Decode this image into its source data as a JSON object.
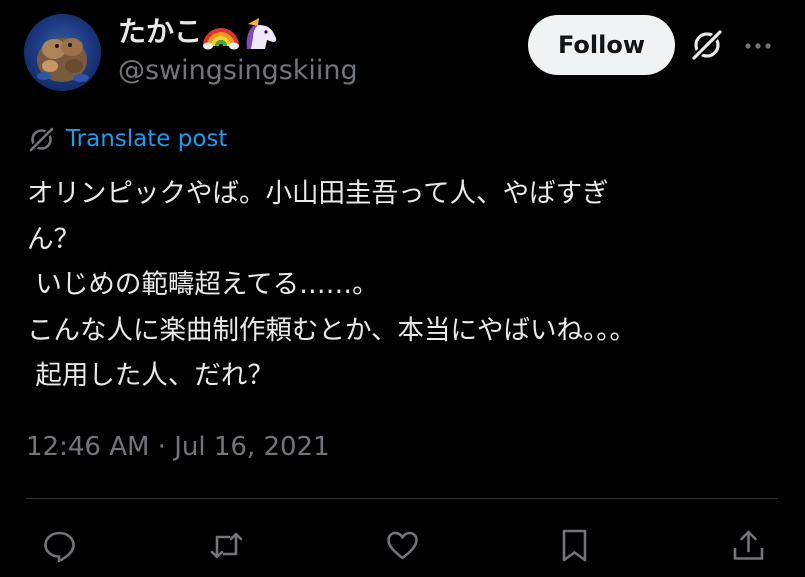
{
  "author": {
    "display_name": "たかこ",
    "emoji_badges": [
      "rainbow-emoji",
      "unicorn-emoji"
    ],
    "handle": "@swingsingskiing",
    "avatar": "avatar-image"
  },
  "header_actions": {
    "follow_label": "Follow",
    "grok_icon": "grok-icon",
    "more_icon": "more-horizontal-icon"
  },
  "translate": {
    "label": "Translate post",
    "icon": "translate-globe-icon"
  },
  "post": {
    "lines": [
      "オリンピックやば。小山田圭吾って人、やばすぎ",
      "ん？",
      " いじめの範疇超えてる……。",
      "こんな人に楽曲制作頼むとか、本当にやばいね。。。",
      " 起用した人、だれ？"
    ],
    "timestamp": "12:46 AM · Jul 16, 2021"
  },
  "actions": [
    "reply-icon",
    "repost-icon",
    "like-icon",
    "bookmark-icon",
    "share-icon"
  ],
  "colors": {
    "background": "#000000",
    "text": "#e7e9ea",
    "muted": "#71767b",
    "link": "#1d9bf0",
    "divider": "#2f3336",
    "follow_bg": "#eff3f4",
    "follow_text": "#0f1419"
  }
}
